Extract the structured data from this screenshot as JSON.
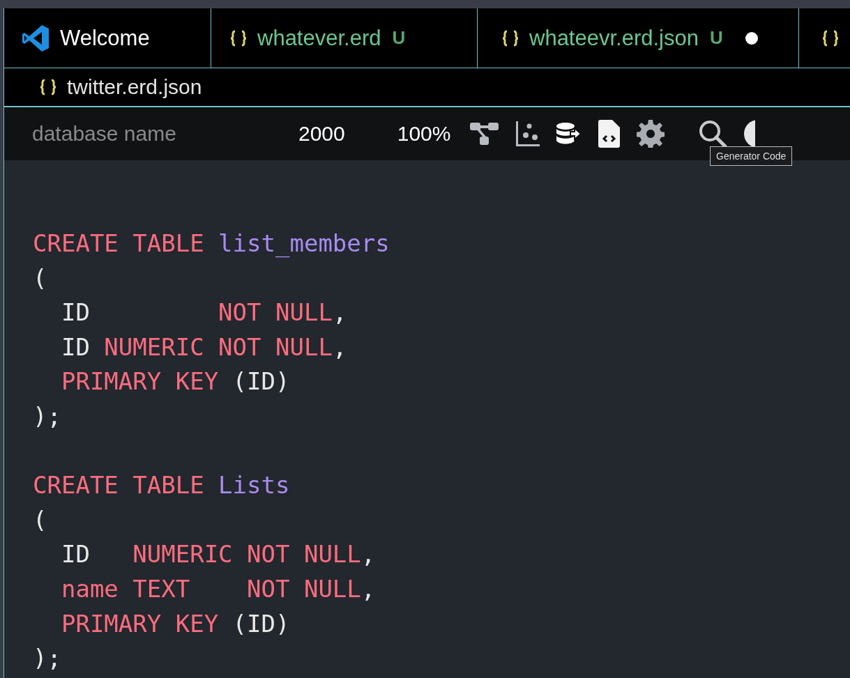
{
  "tabs": [
    {
      "kind": "vscode",
      "label": "Welcome",
      "untracked": false,
      "modified": false
    },
    {
      "kind": "json",
      "label": "whatever.erd",
      "untracked": true,
      "badge": "U",
      "modified": false
    },
    {
      "kind": "json",
      "label": "whateevr.erd.json",
      "untracked": true,
      "badge": "U",
      "modified": true
    },
    {
      "kind": "json"
    },
    {
      "kind": "json",
      "label": "twitter.erd.json",
      "untracked": false,
      "modified": false
    }
  ],
  "toolbar": {
    "database_name": {
      "placeholder": "database name"
    },
    "canvas_size": "2000",
    "zoom": "100%",
    "tooltip": "Generator Code"
  },
  "code": [
    [
      [
        {
          "text": "CREATE TABLE ",
          "kind": "keyword"
        },
        {
          "text": "list_members",
          "kind": "name"
        }
      ],
      [
        {
          "text": "(",
          "kind": "plain"
        }
      ],
      [
        {
          "text": "  ID         ",
          "kind": "plain"
        },
        {
          "text": "NOT NULL",
          "kind": "keyword"
        },
        {
          "text": ",",
          "kind": "plain"
        }
      ],
      [
        {
          "text": "  ID ",
          "kind": "plain"
        },
        {
          "text": "NUMERIC NOT NULL",
          "kind": "keyword"
        },
        {
          "text": ",",
          "kind": "plain"
        }
      ],
      [
        {
          "text": "  PRIMARY KEY ",
          "kind": "keyword"
        },
        {
          "text": "(ID)",
          "kind": "plain"
        }
      ],
      [
        {
          "text": ");",
          "kind": "plain"
        }
      ]
    ],
    [
      [
        {
          "text": "CREATE TABLE ",
          "kind": "keyword"
        },
        {
          "text": "Lists",
          "kind": "name"
        }
      ],
      [
        {
          "text": "(",
          "kind": "plain"
        }
      ],
      [
        {
          "text": "  ID   ",
          "kind": "plain"
        },
        {
          "text": "NUMERIC NOT NULL",
          "kind": "keyword"
        },
        {
          "text": ",",
          "kind": "plain"
        }
      ],
      [
        {
          "text": "  name TEXT    NOT NULL",
          "kind": "keyword"
        },
        {
          "text": ",",
          "kind": "plain"
        }
      ],
      [
        {
          "text": "  PRIMARY KEY ",
          "kind": "keyword"
        },
        {
          "text": "(ID)",
          "kind": "plain"
        }
      ],
      [
        {
          "text": ");",
          "kind": "plain"
        }
      ]
    ]
  ]
}
